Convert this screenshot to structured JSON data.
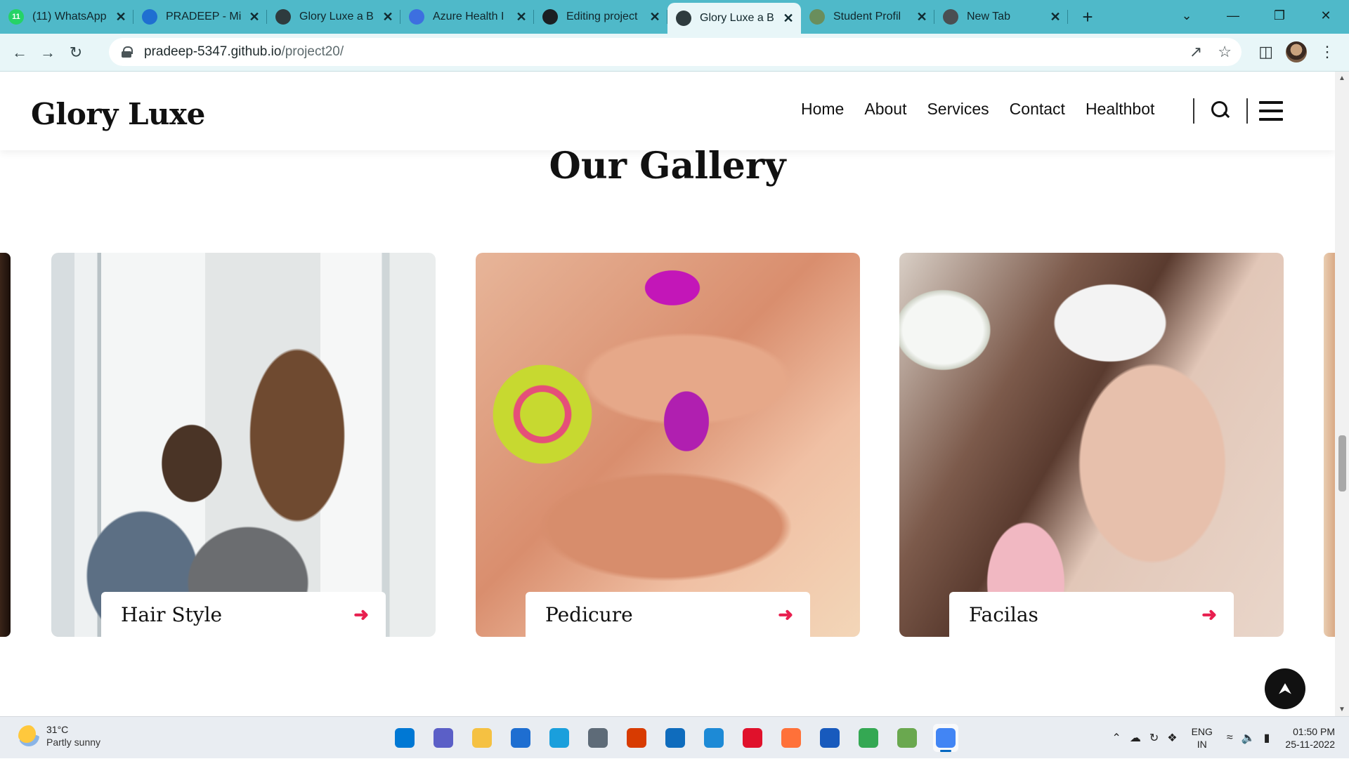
{
  "browser": {
    "tabs": [
      {
        "title": "(11) WhatsApp",
        "icon": "whatsapp-icon",
        "fav_text": "11",
        "color": "#25d366"
      },
      {
        "title": "PRADEEP - Mi",
        "icon": "azure-icon",
        "fav_text": "",
        "color": "#1f6fd1"
      },
      {
        "title": "Glory Luxe a B",
        "icon": "globe-icon",
        "fav_text": "",
        "color": "#2e3b3e"
      },
      {
        "title": "Azure Health I",
        "icon": "azure-health-icon",
        "fav_text": "",
        "color": "#3d6fe0"
      },
      {
        "title": "Editing project",
        "icon": "github-icon",
        "fav_text": "",
        "color": "#1b1f23"
      },
      {
        "title": "Glory Luxe a B",
        "icon": "globe-icon",
        "fav_text": "",
        "color": "#2e3b3e",
        "active": true
      },
      {
        "title": "Student Profil",
        "icon": "student-profile-icon",
        "fav_text": "",
        "color": "#6a8e5c"
      },
      {
        "title": "New Tab",
        "icon": "chrome-icon",
        "fav_text": "",
        "color": "#4a4f52"
      }
    ],
    "url_host": "pradeep-5347.github.io",
    "url_path": "/project20/"
  },
  "site": {
    "logo": "Glory Luxe",
    "nav": [
      "Home",
      "About",
      "Services",
      "Contact",
      "Healthbot"
    ]
  },
  "gallery": {
    "title": "Our Gallery",
    "cards": [
      {
        "label": "Hair Style"
      },
      {
        "label": "Pedicure"
      },
      {
        "label": "Facilas"
      }
    ],
    "accent_color": "#e81f4f"
  },
  "taskbar": {
    "weather_temp": "31°C",
    "weather_text": "Partly sunny",
    "lang_top": "ENG",
    "lang_bottom": "IN",
    "time": "01:50 PM",
    "date": "25-11-2022",
    "apps": [
      {
        "name": "start-button",
        "color": "#0078d4"
      },
      {
        "name": "teams-chat-icon",
        "color": "#5b5fc7"
      },
      {
        "name": "file-explorer-icon",
        "color": "#f5c142"
      },
      {
        "name": "microsoft-store-icon",
        "color": "#1e6ed1"
      },
      {
        "name": "edge-icon",
        "color": "#1a9fdc"
      },
      {
        "name": "settings-icon",
        "color": "#5e6b78"
      },
      {
        "name": "office-icon",
        "color": "#d83b01"
      },
      {
        "name": "mail-icon",
        "color": "#0f6cbd"
      },
      {
        "name": "rdp-icon",
        "color": "#1d8ad6"
      },
      {
        "name": "opera-icon",
        "color": "#e0112b"
      },
      {
        "name": "firefox-icon",
        "color": "#ff7139"
      },
      {
        "name": "word-icon",
        "color": "#185abd"
      },
      {
        "name": "chrome-icon",
        "color": "#34a853"
      },
      {
        "name": "app-icon",
        "color": "#6aa84f"
      },
      {
        "name": "chrome-profile-icon",
        "color": "#4285f4",
        "active": true
      }
    ]
  }
}
